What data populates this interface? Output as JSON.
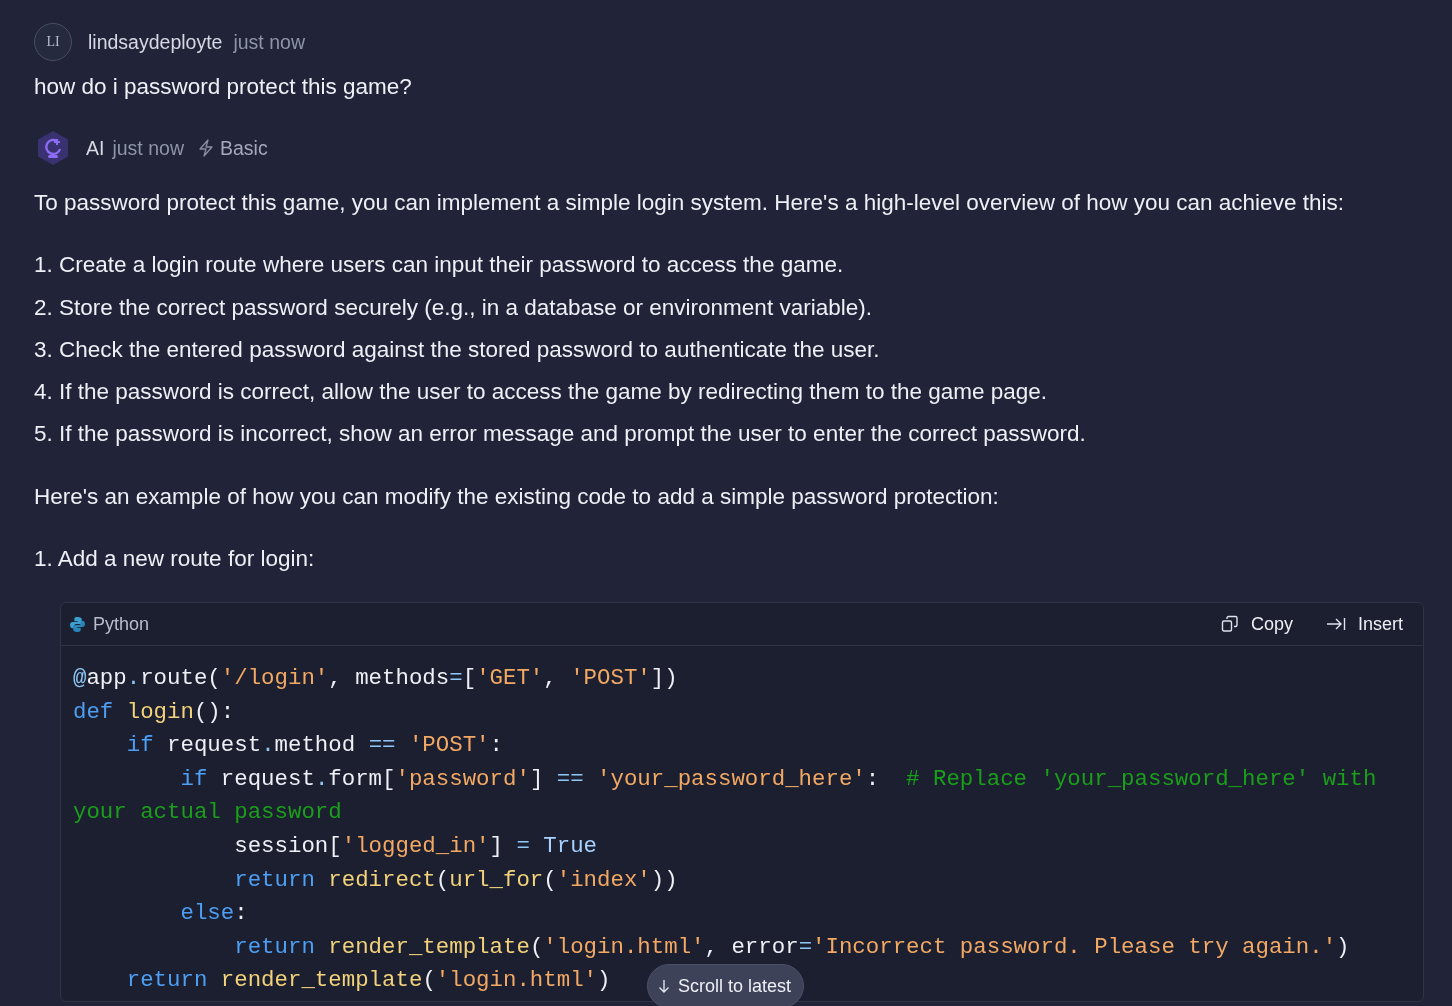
{
  "user_message": {
    "avatar_initials": "LI",
    "author": "lindsaydeployte",
    "time": "just now",
    "text": "how do i password protect this game?"
  },
  "ai_message": {
    "author": "AI",
    "time": "just now",
    "mode": "Basic",
    "intro": "To password protect this game, you can implement a simple login system. Here's a high-level overview of how you can achieve this:",
    "steps": [
      "1. Create a login route where users can input their password to access the game.",
      "2. Store the correct password securely (e.g., in a database or environment variable).",
      "3. Check the entered password against the stored password to authenticate the user.",
      "4. If the password is correct, allow the user to access the game by redirecting them to the game page.",
      "5. If the password is incorrect, show an error message and prompt the user to enter the correct password."
    ],
    "example_intro": "Here's an example of how you can modify the existing code to add a simple password protection:",
    "sub_step": "1. Add a new route for login:",
    "code_block": {
      "language": "Python",
      "copy_label": "Copy",
      "insert_label": "Insert",
      "lines": [
        [
          {
            "kind": "op",
            "text": "@"
          },
          {
            "kind": "plain",
            "text": "app"
          },
          {
            "kind": "op",
            "text": "."
          },
          {
            "kind": "plain",
            "text": "route("
          },
          {
            "kind": "string",
            "text": "'/login'"
          },
          {
            "kind": "plain",
            "text": ", methods"
          },
          {
            "kind": "op",
            "text": "="
          },
          {
            "kind": "plain",
            "text": "["
          },
          {
            "kind": "string",
            "text": "'GET'"
          },
          {
            "kind": "plain",
            "text": ", "
          },
          {
            "kind": "string",
            "text": "'POST'"
          },
          {
            "kind": "plain",
            "text": "])"
          }
        ],
        [
          {
            "kind": "keyword",
            "text": "def "
          },
          {
            "kind": "function",
            "text": "login"
          },
          {
            "kind": "plain",
            "text": "():"
          }
        ],
        [
          {
            "kind": "keyword",
            "text": "    if"
          },
          {
            "kind": "plain",
            "text": " request"
          },
          {
            "kind": "op",
            "text": "."
          },
          {
            "kind": "plain",
            "text": "method "
          },
          {
            "kind": "op",
            "text": "== "
          },
          {
            "kind": "string",
            "text": "'POST'"
          },
          {
            "kind": "plain",
            "text": ":"
          }
        ],
        [
          {
            "kind": "keyword",
            "text": "        if"
          },
          {
            "kind": "plain",
            "text": " request"
          },
          {
            "kind": "op",
            "text": "."
          },
          {
            "kind": "plain",
            "text": "form["
          },
          {
            "kind": "string",
            "text": "'password'"
          },
          {
            "kind": "plain",
            "text": "] "
          },
          {
            "kind": "op",
            "text": "== "
          },
          {
            "kind": "string",
            "text": "'your_password_here'"
          },
          {
            "kind": "plain",
            "text": ":  "
          },
          {
            "kind": "comment",
            "text": "# Replace 'your_password_here' with your actual password"
          }
        ],
        [
          {
            "kind": "plain",
            "text": "            session["
          },
          {
            "kind": "string",
            "text": "'logged_in'"
          },
          {
            "kind": "plain",
            "text": "] "
          },
          {
            "kind": "op",
            "text": "= "
          },
          {
            "kind": "constant",
            "text": "True"
          }
        ],
        [
          {
            "kind": "keyword",
            "text": "            return "
          },
          {
            "kind": "function",
            "text": "redirect"
          },
          {
            "kind": "plain",
            "text": "("
          },
          {
            "kind": "function",
            "text": "url_for"
          },
          {
            "kind": "plain",
            "text": "("
          },
          {
            "kind": "string",
            "text": "'index'"
          },
          {
            "kind": "plain",
            "text": "))"
          }
        ],
        [
          {
            "kind": "keyword",
            "text": "        else"
          },
          {
            "kind": "plain",
            "text": ":"
          }
        ],
        [
          {
            "kind": "keyword",
            "text": "            return "
          },
          {
            "kind": "function",
            "text": "render_template"
          },
          {
            "kind": "plain",
            "text": "("
          },
          {
            "kind": "string",
            "text": "'login.html'"
          },
          {
            "kind": "plain",
            "text": ", error"
          },
          {
            "kind": "op",
            "text": "="
          },
          {
            "kind": "string",
            "text": "'Incorrect password. Please try again.'"
          },
          {
            "kind": "plain",
            "text": ")"
          }
        ],
        [
          {
            "kind": "keyword",
            "text": "    return "
          },
          {
            "kind": "function",
            "text": "render_template"
          },
          {
            "kind": "plain",
            "text": "("
          },
          {
            "kind": "string",
            "text": "'login.html'"
          },
          {
            "kind": "plain",
            "text": ")"
          }
        ]
      ]
    }
  },
  "scroll_button": {
    "label": "Scroll to latest"
  }
}
